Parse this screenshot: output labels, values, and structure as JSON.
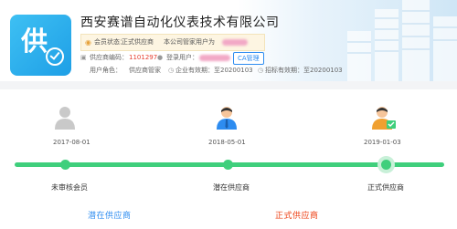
{
  "company": {
    "icon_char": "供",
    "name": "西安赛谱自动化仪表技术有限公司"
  },
  "status": {
    "member_status_label": "会员状态：",
    "member_status_value": "正式供应商",
    "admin_label": "本公司管家用户为"
  },
  "info": {
    "supplier_code_label": "供应商编码：",
    "supplier_code_value": "1101297",
    "login_user_label": "登录用户：",
    "ca_button": "CA管理",
    "role_label": "用户角色：",
    "role_value": "供应商管家",
    "auth_label": "企业有效期：",
    "auth_value": "至20200103",
    "qual_label": "招标有效期：",
    "qual_value": "至20200103"
  },
  "timeline": {
    "milestones": [
      {
        "date": "2017-08-01",
        "label": "未审核会员",
        "icon": "user-gray-icon"
      },
      {
        "date": "2018-05-01",
        "label": "潜在供应商",
        "icon": "user-blue-icon"
      },
      {
        "date": "2019-01-03",
        "label": "正式供应商",
        "icon": "user-orange-certified-icon"
      }
    ]
  },
  "links": {
    "potential": "潜在供应商",
    "formal": "正式供应商"
  },
  "colors": {
    "accent_blue": "#2d8cf0",
    "accent_red": "#ed4014",
    "timeline_green": "#3fcf7c",
    "icon_blue": "#1e9fe6"
  }
}
